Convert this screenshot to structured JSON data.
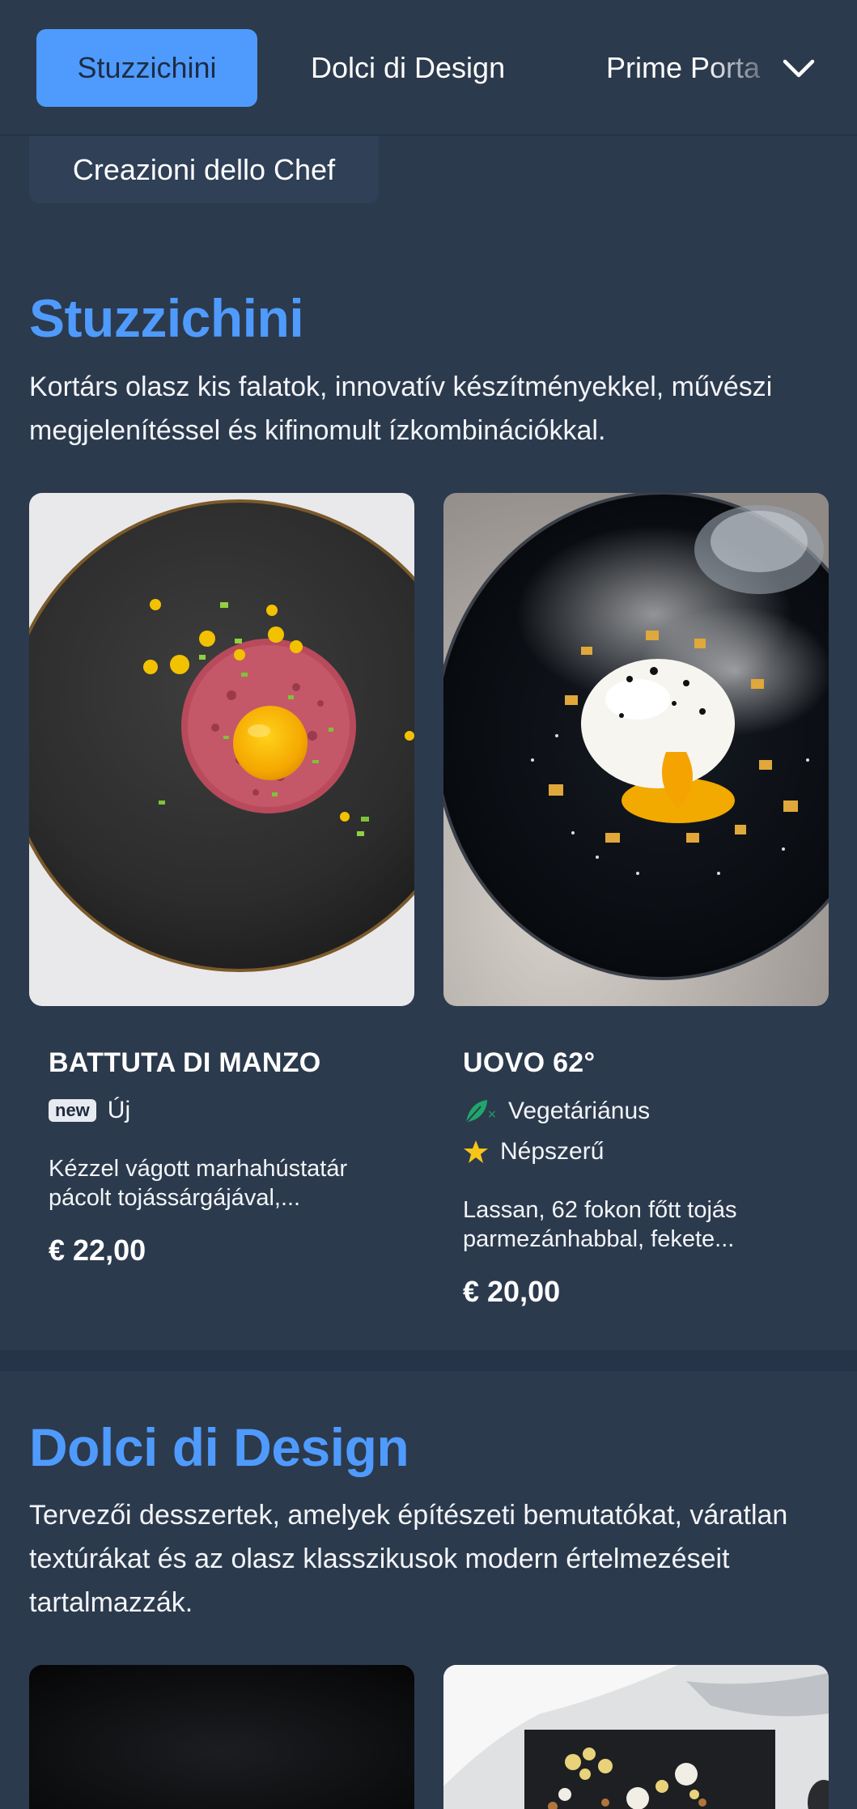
{
  "nav": {
    "tabs": [
      {
        "label": "Stuzzichini",
        "active": true
      },
      {
        "label": "Dolci di Design",
        "active": false
      },
      {
        "label": "Prime Portate",
        "active": false
      }
    ],
    "overflow_tab": "Creazioni dello Chef",
    "expand_icon": "chevron-down-icon"
  },
  "sections": [
    {
      "title": "Stuzzichini",
      "description": "Kortárs olasz kis falatok, innovatív készítményekkel, művészi megjelenítéssel és kifinomult ízkombinációkkal.",
      "items": [
        {
          "name": "BATTUTA DI MANZO",
          "badge": "new",
          "tags": [
            "Új"
          ],
          "description": "Kézzel vágott marhahústatár pácolt tojássárgájával,...",
          "price": "€ 22,00"
        },
        {
          "name": "UOVO 62°",
          "tags": [
            "Vegetáriánus",
            "Népszerű"
          ],
          "description": "Lassan, 62 fokon főtt tojás parmezánhabbal, fekete...",
          "price": "€ 20,00"
        }
      ]
    },
    {
      "title": "Dolci di Design",
      "description": "Tervezői desszertek, amelyek építészeti bemutatókat, váratlan textúrákat és az olasz klasszikusok modern értelmezéseit tartalmazzák."
    }
  ],
  "colors": {
    "background": "#2c3a4d",
    "accent": "#4f9bfd",
    "veg_icon": "#1fa66a",
    "star": "#f5c518"
  }
}
